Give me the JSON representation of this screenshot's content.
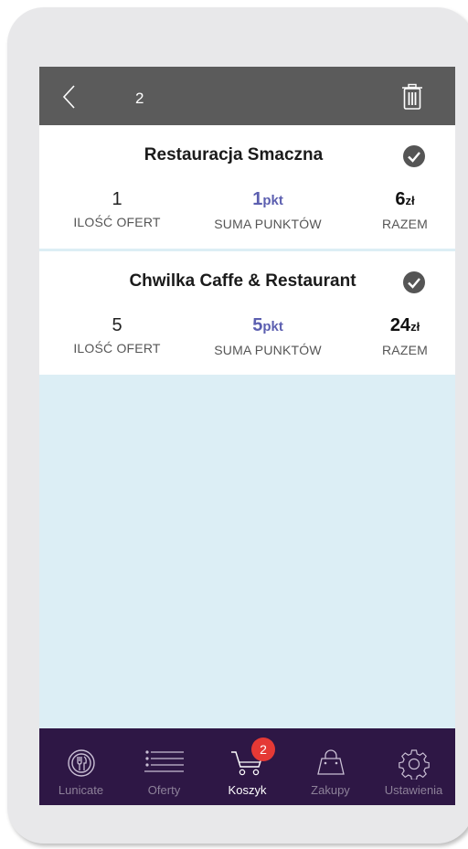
{
  "header": {
    "count": "2"
  },
  "restaurants": [
    {
      "name": "Restauracja Smaczna",
      "offers_count": "1",
      "offers_label": "ILOŚĆ OFERT",
      "points": "1",
      "points_unit": "pkt",
      "points_label": "SUMA PUNKTÓW",
      "total": "6",
      "total_unit": "zł",
      "total_label": "RAZEM"
    },
    {
      "name": "Chwilka Caffe & Restaurant",
      "offers_count": "5",
      "offers_label": "ILOŚĆ OFERT",
      "points": "5",
      "points_unit": "pkt",
      "points_label": "SUMA PUNKTÓW",
      "total": "24",
      "total_unit": "zł",
      "total_label": "RAZEM"
    }
  ],
  "nav": {
    "items": [
      {
        "label": "Lunicate",
        "icon": "lunicate-icon"
      },
      {
        "label": "Oferty",
        "icon": "list-icon"
      },
      {
        "label": "Koszyk",
        "icon": "cart-icon",
        "badge": "2",
        "active": true
      },
      {
        "label": "Zakupy",
        "icon": "bag-icon"
      },
      {
        "label": "Ustawienia",
        "icon": "gear-icon"
      }
    ]
  },
  "colors": {
    "topbar": "#5b5b5b",
    "nav_background": "#2e1745",
    "accent_points": "#5c5fb0",
    "badge": "#e53935",
    "empty_area": "#dceef5"
  }
}
